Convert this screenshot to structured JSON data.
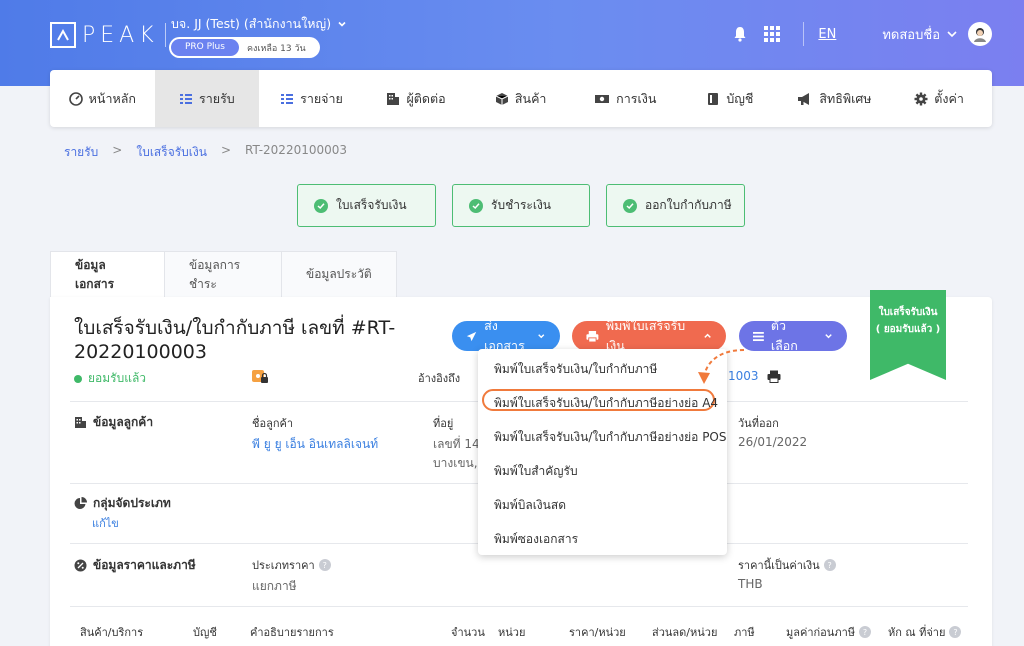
{
  "header": {
    "logo_text": "PEAK",
    "company_name": "บจ. JJ (Test) (สำนักงานใหญ่)",
    "plan_name": "PRO Plus",
    "plan_remaining": "คงเหลือ 13 วัน",
    "language": "EN",
    "username": "ทดสอบชื่อ"
  },
  "nav": {
    "items": [
      {
        "label": "หน้าหลัก",
        "icon": "dashboard-icon"
      },
      {
        "label": "รายรับ",
        "icon": "income-icon"
      },
      {
        "label": "รายจ่าย",
        "icon": "expense-icon"
      },
      {
        "label": "ผู้ติดต่อ",
        "icon": "contacts-icon"
      },
      {
        "label": "สินค้า",
        "icon": "box-icon"
      },
      {
        "label": "การเงิน",
        "icon": "money-icon"
      },
      {
        "label": "บัญชี",
        "icon": "book-icon"
      },
      {
        "label": "สิทธิพิเศษ",
        "icon": "megaphone-icon"
      },
      {
        "label": "ตั้งค่า",
        "icon": "gear-icon"
      }
    ],
    "active_index": 1
  },
  "breadcrumb": {
    "level1": "รายรับ",
    "level2": "ใบเสร็จรับเงิน",
    "current": "RT-20220100003",
    "separator": ">"
  },
  "steps": [
    "ใบเสร็จรับเงิน",
    "รับชำระเงิน",
    "ออกใบกำกับภาษี"
  ],
  "tabs": [
    "ข้อมูลเอกสาร",
    "ข้อมูลการชำระ",
    "ข้อมูลประวัติ"
  ],
  "ribbon": {
    "line1": "ใบเสร็จรับเงิน",
    "line2": "( ยอมรับแล้ว )"
  },
  "document": {
    "title_line1": "ใบเสร็จรับเงิน/ใบกำกับภาษี เลขที่ #RT-",
    "title_line2": "20220100003",
    "status": "ยอมรับแล้ว",
    "ref_label": "อ้างอิงถึง",
    "ref_value": "1003"
  },
  "buttons": {
    "send": "ส่งเอกสาร",
    "print": "พิมพ์ใบเสร็จรับเงิน",
    "options": "ตัวเลือก"
  },
  "print_menu": {
    "items": [
      "พิมพ์ใบเสร็จรับเงิน/ใบกำกับภาษี",
      "พิมพ์ใบเสร็จรับเงิน/ใบกำกับภาษีอย่างย่อ A4",
      "พิมพ์ใบเสร็จรับเงิน/ใบกำกับภาษีอย่างย่อ POS",
      "พิมพ์ใบสำคัญรับ",
      "พิมพ์บิลเงินสด",
      "พิมพ์ซองเอกสาร"
    ],
    "selected_index": 1
  },
  "customer": {
    "section": "ข้อมูลลูกค้า",
    "name_label": "ชื่อลูกค้า",
    "name_value": "พี ยู ยู เอ็น อินเทลลิเจนท์",
    "address_label": "ที่อยู่",
    "address_line1": "เลขที่ 145",
    "address_line2": "บางเขน,",
    "date_label": "วันที่ออก",
    "date_value": "26/01/2022"
  },
  "classification": {
    "section": "กลุ่มจัดประเภท",
    "edit_link": "แก้ไข"
  },
  "pricing": {
    "section": "ข้อมูลราคาและภาษี",
    "price_type_label": "ประเภทราคา",
    "price_type_value": "แยกภาษี",
    "currency_label": "ราคานี้เป็นค่าเงิน",
    "currency_value": "THB"
  },
  "table": {
    "columns": [
      "สินค้า/บริการ",
      "บัญชี",
      "คำอธิบายรายการ",
      "จำนวน",
      "หน่วย",
      "ราคา/หน่วย",
      "ส่วนลด/หน่วย",
      "ภาษี",
      "มูลค่าก่อนภาษี",
      "หัก ณ ที่จ่าย"
    ]
  },
  "colors": {
    "primary": "#4f7be8",
    "success": "#3fb968",
    "print_button": "#f06a4f",
    "send_button": "#3a8ff0",
    "options_button": "#6d74e6",
    "highlight": "#f07a3c"
  }
}
